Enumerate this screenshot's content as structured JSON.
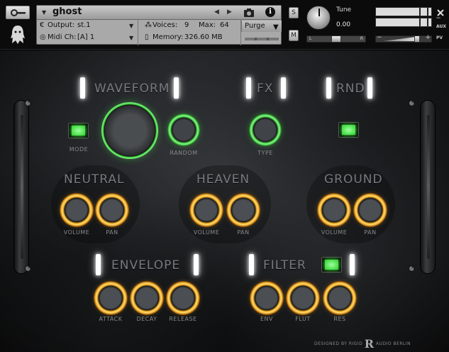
{
  "header": {
    "instrument_name": "ghost",
    "output_label": "Output:",
    "output_value": "st.1",
    "voices_label": "Voices:",
    "voices_value": "9",
    "max_label": "Max:",
    "max_value": "64",
    "purge_label": "Purge",
    "midi_label": "Midi Ch:",
    "midi_value": "[A]  1",
    "memory_label": "Memory:",
    "memory_value": "326.60 MB",
    "solo_label": "S",
    "mute_label": "M",
    "tune_label": "Tune",
    "tune_value": "0.00",
    "pan_left": "L",
    "pan_right": "R",
    "aux_label": "AUX",
    "pv_label": "PV",
    "minus": "−",
    "plus": "+",
    "info": "i"
  },
  "sections": {
    "waveform": "WAVEFORM",
    "fx": "FX",
    "rnd": "RND",
    "neutral": "NEUTRAL",
    "heaven": "HEAVEN",
    "ground": "GROUND",
    "envelope": "ENVELOPE",
    "filter": "FILTER"
  },
  "labels": {
    "mode": "MODE",
    "random": "RANDOM",
    "type": "TYPE",
    "volume": "VOLUME",
    "pan": "PAN",
    "attack": "ATTACK",
    "decay": "DECAY",
    "release": "RELEASE",
    "env": "ENV",
    "flut": "FLUT",
    "res": "RES"
  },
  "credit": {
    "designed_by": "DESIGNED BY",
    "rigid": "RIGID",
    "logo_letter": "R",
    "audio": "AUDIO",
    "berlin": "BERLIN"
  },
  "colors": {
    "green_accent": "#3ecf3e",
    "orange_accent": "#f0a020",
    "lamp_white": "#ffffff"
  }
}
